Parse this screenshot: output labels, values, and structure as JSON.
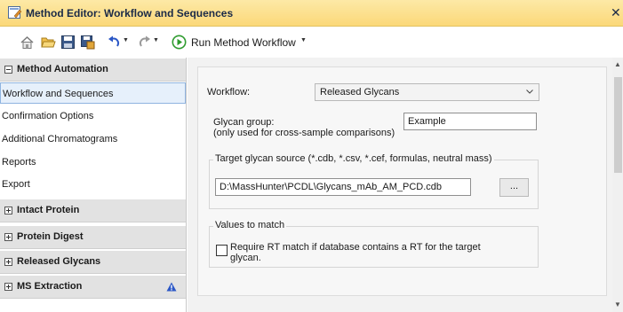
{
  "window": {
    "title": "Method Editor: Workflow and Sequences",
    "close_glyph": "✕"
  },
  "toolbar": {
    "icons": [
      "home-icon",
      "open-folder-icon",
      "save-icon",
      "save-as-icon",
      "undo-icon",
      "redo-icon",
      "run-play-icon"
    ],
    "run_label": "Run Method Workflow",
    "caret": "▼"
  },
  "sidebar": {
    "method_automation": {
      "header": "Method Automation",
      "items": [
        {
          "label": "Workflow and Sequences",
          "selected": true
        },
        {
          "label": "Confirmation Options"
        },
        {
          "label": "Additional Chromatograms"
        },
        {
          "label": "Reports"
        },
        {
          "label": "Export"
        }
      ]
    },
    "collapsed_groups": [
      {
        "label": "Intact Protein"
      },
      {
        "label": "Protein Digest"
      },
      {
        "label": "Released Glycans"
      },
      {
        "label": "MS Extraction",
        "icon": "warning-triangle-icon"
      }
    ]
  },
  "main": {
    "workflow_label": "Workflow:",
    "workflow_value": "Released Glycans",
    "glycan_group_label": "Glycan group:",
    "glycan_group_hint": "(only used for cross-sample comparisons)",
    "glycan_group_value": "Example",
    "source_group_title": "Target glycan source (*.cdb, *.csv, *.cef, formulas, neutral mass)",
    "source_path": "D:\\MassHunter\\PCDL\\Glycans_mAb_AM_PCD.cdb",
    "browse_label": "...",
    "values_group_title": "Values to match",
    "rt_match_line1": "Require RT match if database contains a RT for the target",
    "rt_match_line2": "glycan.",
    "rt_match_checked": false
  },
  "colors": {
    "title_bar": "#fbd879",
    "selection": "#e6f0fb",
    "group_header": "#e2e2e2",
    "run_green": "#2e9b2e",
    "warning_blue": "#2b57c6"
  }
}
